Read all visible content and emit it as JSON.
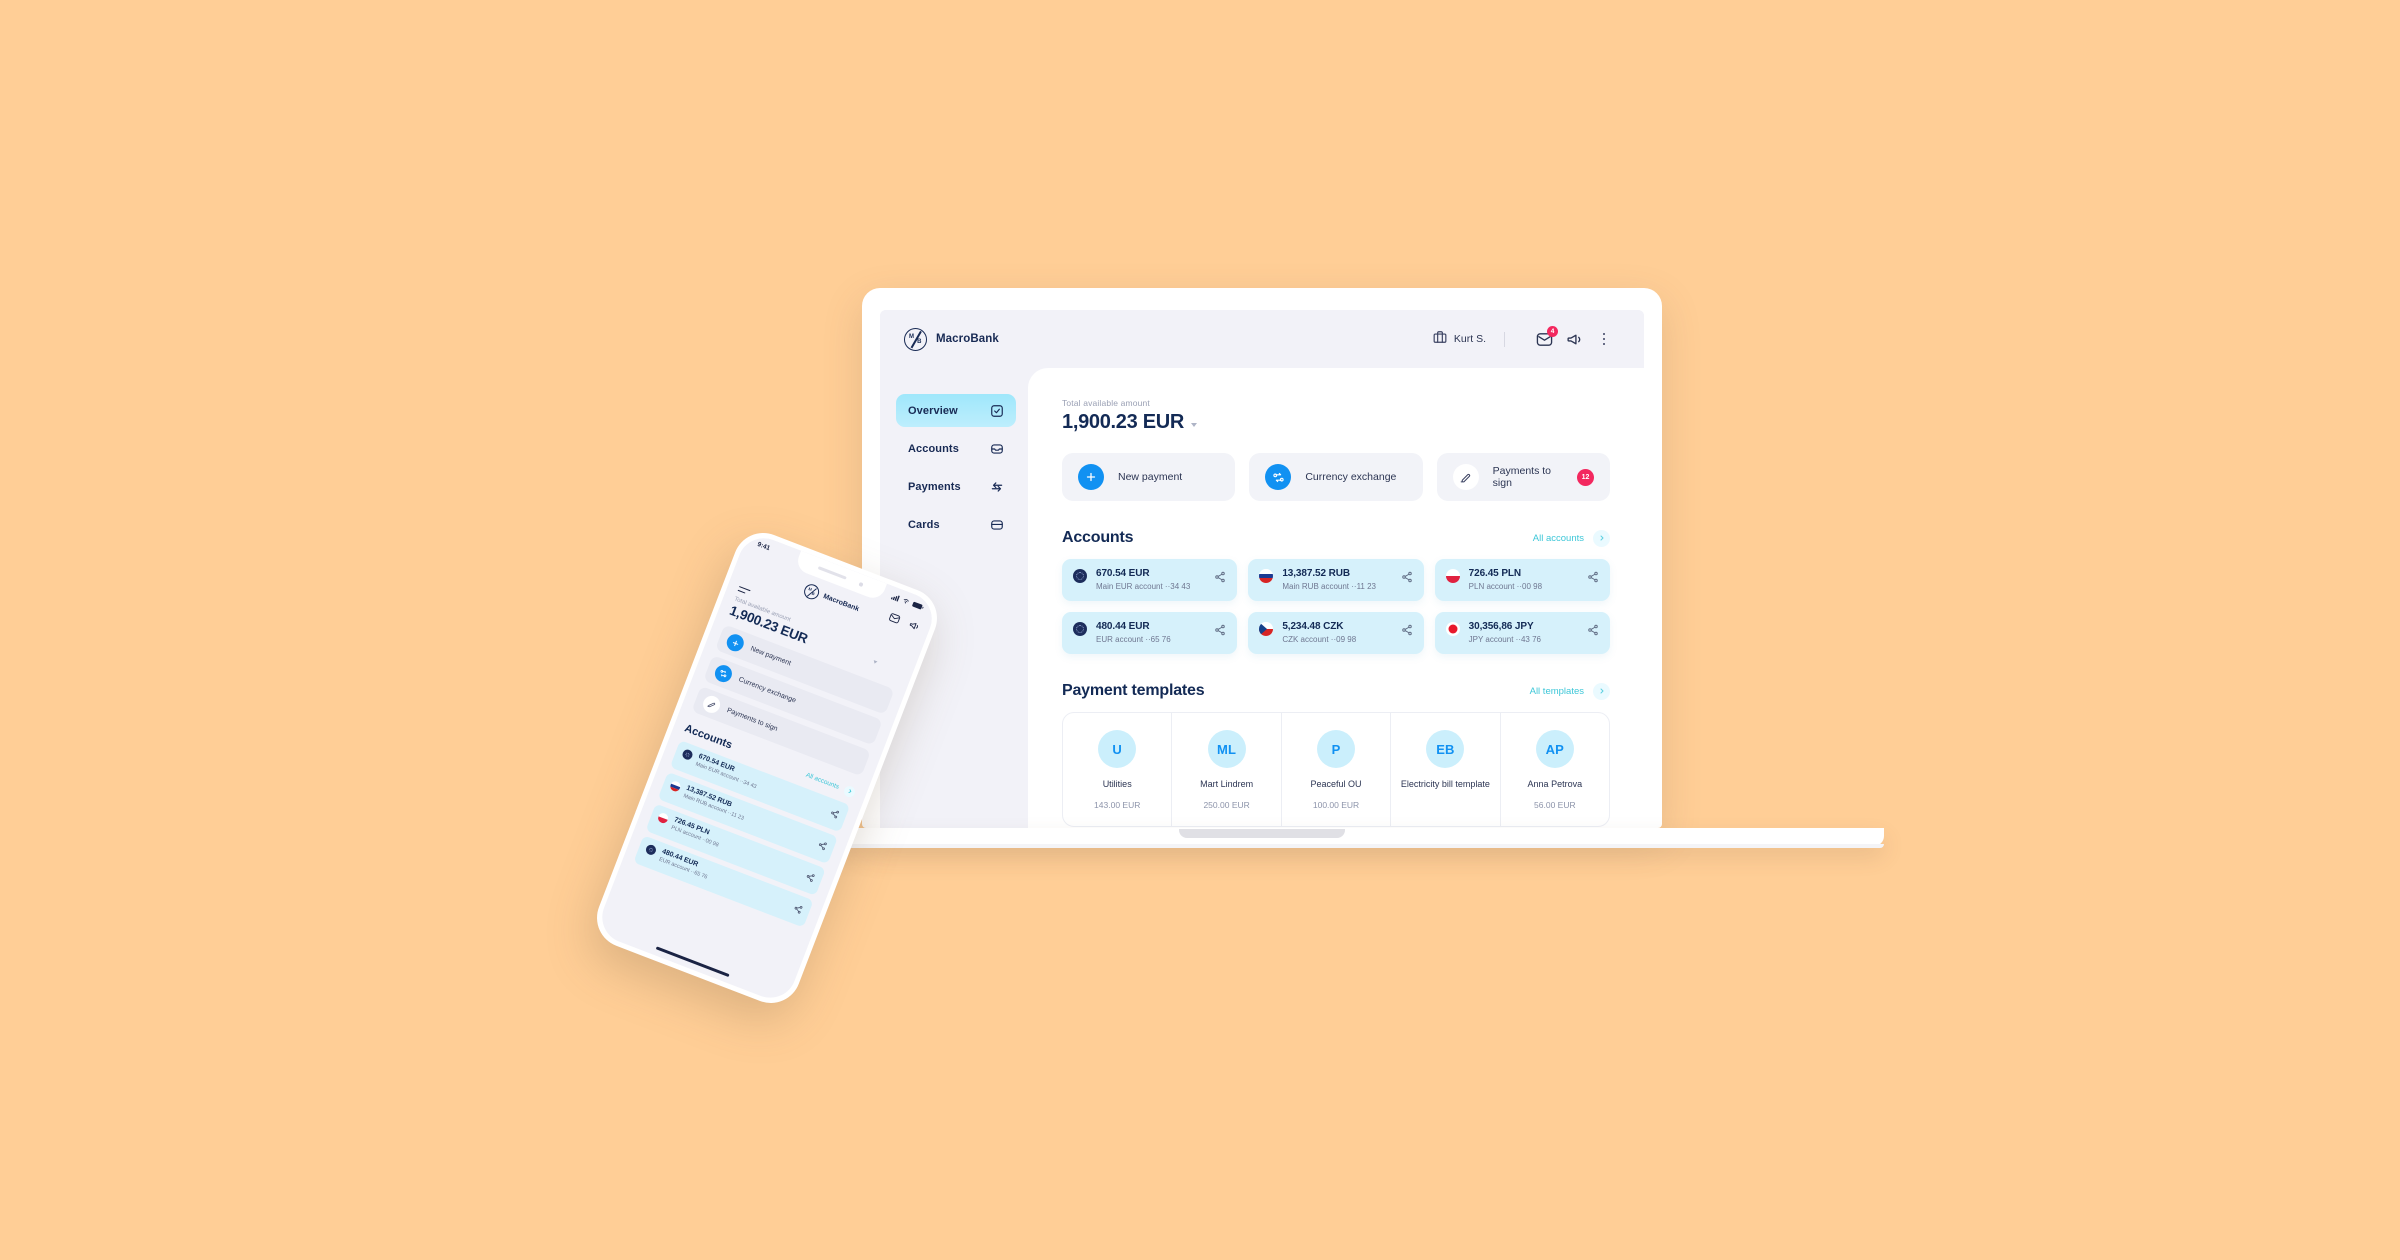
{
  "background_color": "#FFCE96",
  "brand": {
    "name": "MacroBank",
    "logo_top": "M",
    "logo_bottom": "B"
  },
  "topbar": {
    "user_name": "Kurt S.",
    "briefcase_icon": "briefcase-icon",
    "chevron_icon": "chevron-down-icon",
    "mail_icon": "mail-icon",
    "mail_badge": "4",
    "megaphone_icon": "megaphone-icon",
    "more_icon": "more-vertical-icon"
  },
  "sidebar": {
    "items": [
      {
        "label": "Overview",
        "icon": "check-square-icon",
        "active": true
      },
      {
        "label": "Accounts",
        "icon": "inbox-icon",
        "active": false
      },
      {
        "label": "Payments",
        "icon": "transfer-arrows-icon",
        "active": false
      },
      {
        "label": "Cards",
        "icon": "card-icon",
        "active": false
      }
    ]
  },
  "balance": {
    "label": "Total available amount",
    "amount": "1,900.23 EUR"
  },
  "actions": [
    {
      "label": "New payment",
      "icon": "plus-icon",
      "badge": null
    },
    {
      "label": "Currency exchange",
      "icon": "exchange-icon",
      "badge": null
    },
    {
      "label": "Payments to sign",
      "icon": "edit-icon",
      "badge": "12"
    }
  ],
  "accounts_section": {
    "title": "Accounts",
    "link_label": "All accounts",
    "accounts": [
      {
        "amount": "670.54 EUR",
        "sub": "Main EUR account ··34 43",
        "flag": "eur"
      },
      {
        "amount": "13,387.52 RUB",
        "sub": "Main RUB account ··11 23",
        "flag": "rub"
      },
      {
        "amount": "726.45 PLN",
        "sub": "PLN account ··00 98",
        "flag": "pln"
      },
      {
        "amount": "480.44 EUR",
        "sub": "EUR account ··65 76",
        "flag": "eur"
      },
      {
        "amount": "5,234.48 CZK",
        "sub": "CZK account ··09 98",
        "flag": "czk"
      },
      {
        "amount": "30,356,86 JPY",
        "sub": "JPY account ··43 76",
        "flag": "jpy"
      }
    ]
  },
  "templates_section": {
    "title": "Payment templates",
    "link_label": "All templates",
    "templates": [
      {
        "initials": "U",
        "name": "Utilities",
        "amount": "143.00 EUR"
      },
      {
        "initials": "ML",
        "name": "Mart Lindrem",
        "amount": "250.00 EUR"
      },
      {
        "initials": "P",
        "name": "Peaceful OU",
        "amount": "100.00 EUR"
      },
      {
        "initials": "EB",
        "name": "Electricity bill template",
        "amount": ""
      },
      {
        "initials": "AP",
        "name": "Anna  Petrova",
        "amount": "56.00 EUR"
      }
    ]
  },
  "phone": {
    "status_time": "9:41",
    "brand_name": "MacroBank",
    "balance_label": "Total available amount",
    "balance_amount": "1,900.23 EUR",
    "actions": [
      {
        "label": "New payment",
        "icon": "plus-icon"
      },
      {
        "label": "Currency exchange",
        "icon": "exchange-icon"
      },
      {
        "label": "Payments to sign",
        "icon": "edit-icon"
      }
    ],
    "accounts_title": "Accounts",
    "accounts_link": "All accounts",
    "accounts": [
      {
        "amount": "670.54 EUR",
        "sub": "Main EUR account ··34 43",
        "flag": "eur"
      },
      {
        "amount": "13,387.52 RUB",
        "sub": "Main RUB account ··11 23",
        "flag": "rub"
      },
      {
        "amount": "726.45 PLN",
        "sub": "PLN account ··00 98",
        "flag": "pln"
      },
      {
        "amount": "480.44 EUR",
        "sub": "EUR account ··65 76",
        "flag": "eur"
      }
    ]
  },
  "colors": {
    "accent_blue": "#1191f2",
    "navy": "#132a55",
    "teal_link": "#3ec7d8",
    "badge_pink": "#f3285f",
    "account_card": "#d6f1fb",
    "nav_active": "#9fe7fb"
  }
}
